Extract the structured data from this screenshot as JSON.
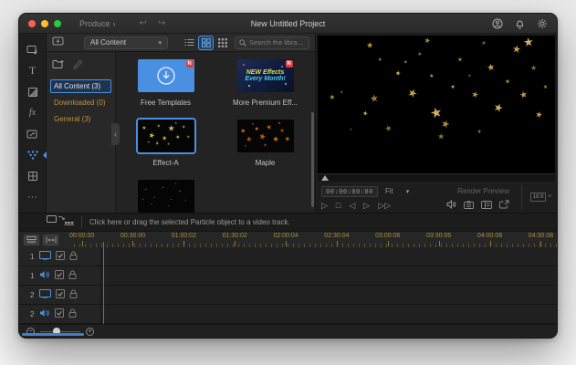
{
  "titlebar": {
    "menu": "Produce",
    "menu_chevron": "›",
    "back": "↩",
    "forward": "↪",
    "title": "New Untitled Project"
  },
  "sidebar": {
    "titles_glyph": "T",
    "effects_glyph": "fx",
    "more_glyph": "···"
  },
  "library": {
    "collection": "All Content",
    "dropdown_caret": "▾",
    "search_placeholder": "Search the libra...",
    "collapse_glyph": "‹",
    "categories": [
      {
        "label": "All Content (3)",
        "selected": true
      },
      {
        "label": "Downloaded (0)"
      },
      {
        "label": "General (3)"
      }
    ],
    "cards": {
      "free_templates": {
        "label": "Free Templates",
        "badge": "N"
      },
      "more_premium": {
        "label": "More Premium Eff...",
        "badge": "N",
        "promo_line1": "NEW Effects",
        "promo_line2": "Every Month!"
      },
      "effect_a": {
        "label": "Effect-A",
        "selected": true
      },
      "maple": {
        "label": "Maple"
      }
    }
  },
  "preview": {
    "timecode": "00:00:00:00",
    "fit": "Fit",
    "fit_caret": "▾",
    "render_preview": "Render Preview",
    "aspect": "16:9",
    "aspect_caret": "˅",
    "transport": {
      "play": "▷",
      "stop": "□",
      "step_back": "◁",
      "step_fwd": "▷",
      "fast_fwd": "▷▷"
    },
    "stars": [
      [
        6,
        45,
        8,
        -15,
        "#a8883e"
      ],
      [
        10,
        42,
        5,
        10,
        "#6e5a28"
      ],
      [
        22,
        8,
        9,
        0,
        "#b99a4a"
      ],
      [
        26,
        18,
        6,
        20,
        "#8a7035"
      ],
      [
        24,
        46,
        11,
        -10,
        "#9a7e3a"
      ],
      [
        20,
        57,
        7,
        15,
        "#c9a24b"
      ],
      [
        30,
        68,
        9,
        -20,
        "#8a7035"
      ],
      [
        34,
        28,
        7,
        10,
        "#d4b060"
      ],
      [
        37,
        20,
        5,
        0,
        "#a8883e"
      ],
      [
        40,
        42,
        12,
        25,
        "#c9a24b"
      ],
      [
        43,
        14,
        6,
        -10,
        "#8a7035"
      ],
      [
        46,
        4,
        8,
        15,
        "#a8883e"
      ],
      [
        48,
        30,
        6,
        0,
        "#b99a4a"
      ],
      [
        50,
        56,
        15,
        -15,
        "#d4b060"
      ],
      [
        54,
        64,
        11,
        20,
        "#b08c3c"
      ],
      [
        52,
        74,
        9,
        0,
        "#8a7035"
      ],
      [
        57,
        38,
        6,
        10,
        "#c9a24b"
      ],
      [
        60,
        18,
        7,
        -5,
        "#9a7e3a"
      ],
      [
        64,
        30,
        5,
        0,
        "#6e5a28"
      ],
      [
        66,
        44,
        9,
        15,
        "#b99a4a"
      ],
      [
        70,
        6,
        6,
        0,
        "#8a7035"
      ],
      [
        73,
        24,
        10,
        -10,
        "#c9a24b"
      ],
      [
        76,
        52,
        12,
        20,
        "#d4b060"
      ],
      [
        80,
        34,
        7,
        0,
        "#a8883e"
      ],
      [
        84,
        10,
        11,
        10,
        "#c9a24b"
      ],
      [
        87,
        44,
        10,
        -15,
        "#b99a4a"
      ],
      [
        91,
        24,
        8,
        0,
        "#8a7035"
      ],
      [
        93,
        58,
        9,
        15,
        "#c9a24b"
      ],
      [
        96,
        38,
        6,
        0,
        "#a8883e"
      ],
      [
        89,
        5,
        13,
        -5,
        "#d4b060"
      ],
      [
        14,
        68,
        4,
        0,
        "#6e5a28"
      ],
      [
        68,
        70,
        6,
        10,
        "#8a7035"
      ]
    ]
  },
  "thumb_art": {
    "effect_a": [
      [
        12,
        28,
        6,
        0,
        "#c9a24b"
      ],
      [
        25,
        50,
        8,
        15,
        "#d4b060"
      ],
      [
        38,
        22,
        5,
        -10,
        "#a8883e"
      ],
      [
        48,
        58,
        7,
        20,
        "#c9a24b"
      ],
      [
        60,
        30,
        9,
        0,
        "#d4b060"
      ],
      [
        72,
        55,
        6,
        -15,
        "#b99a4a"
      ],
      [
        82,
        25,
        5,
        10,
        "#a8883e"
      ],
      [
        20,
        70,
        4,
        0,
        "#8a7035"
      ],
      [
        55,
        75,
        4,
        0,
        "#a8883e"
      ],
      [
        68,
        10,
        4,
        0,
        "#8a7035"
      ],
      [
        35,
        75,
        5,
        10,
        "#b99a4a"
      ],
      [
        90,
        55,
        5,
        0,
        "#8a7035"
      ]
    ],
    "maple": [
      [
        10,
        35,
        7,
        20,
        "#c26a14"
      ],
      [
        22,
        60,
        8,
        -15,
        "#a85510"
      ],
      [
        35,
        30,
        6,
        0,
        "#d4781a"
      ],
      [
        45,
        55,
        9,
        15,
        "#b85e12"
      ],
      [
        58,
        25,
        7,
        -20,
        "#c26a14"
      ],
      [
        68,
        60,
        8,
        10,
        "#d4781a"
      ],
      [
        80,
        35,
        6,
        0,
        "#a85510"
      ],
      [
        90,
        60,
        7,
        -10,
        "#c26a14"
      ],
      [
        28,
        15,
        4,
        0,
        "#8a4a10"
      ],
      [
        75,
        15,
        5,
        0,
        "#8a4a10"
      ],
      [
        50,
        80,
        5,
        0,
        "#8a4a10"
      ],
      [
        15,
        80,
        4,
        0,
        "#6e3a0c"
      ]
    ],
    "snow": [
      [
        15,
        30,
        2,
        0,
        "#cccccc"
      ],
      [
        30,
        55,
        2,
        0,
        "#999999"
      ],
      [
        45,
        25,
        2,
        0,
        "#bbbbbb"
      ],
      [
        60,
        60,
        2,
        0,
        "#888888"
      ],
      [
        75,
        35,
        2,
        0,
        "#cccccc"
      ],
      [
        85,
        65,
        2,
        0,
        "#999999"
      ],
      [
        25,
        75,
        2,
        0,
        "#aaaaaa"
      ],
      [
        55,
        80,
        2,
        0,
        "#888888"
      ],
      [
        10,
        60,
        2,
        0,
        "#999999"
      ],
      [
        68,
        15,
        2,
        0,
        "#aaaaaa"
      ]
    ]
  },
  "timeline": {
    "hint": "Click here or drag the selected Particle object to a video track.",
    "ruler": [
      "00:00:00",
      "00:30:00",
      "01:00:02",
      "01:30:02",
      "02:00:04",
      "02:30:04",
      "03:00:06",
      "03:30:06",
      "04:00:08",
      "04:30:08"
    ],
    "tracks": [
      {
        "number": "1",
        "type": "video"
      },
      {
        "number": "1",
        "type": "audio"
      },
      {
        "number": "2",
        "type": "video"
      },
      {
        "number": "2",
        "type": "audio"
      }
    ],
    "zoom_minus": "−",
    "zoom_plus": "+"
  }
}
